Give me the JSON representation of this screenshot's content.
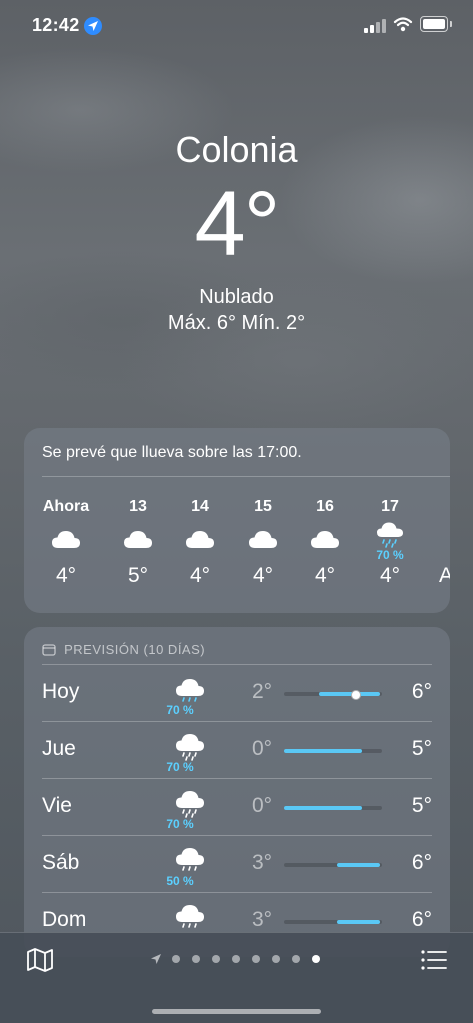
{
  "status": {
    "time": "12:42"
  },
  "location": {
    "city": "Colonia",
    "temperature": "4°",
    "condition": "Nublado",
    "high_low": "Máx. 6°  Mín. 2°"
  },
  "hourly": {
    "summary": "Se prevé que llueva sobre las 17:00.",
    "items": [
      {
        "label": "Ahora",
        "icon": "cloud-icon",
        "temp": "4°",
        "precip": ""
      },
      {
        "label": "13",
        "icon": "cloud-icon",
        "temp": "5°",
        "precip": ""
      },
      {
        "label": "14",
        "icon": "cloud-icon",
        "temp": "4°",
        "precip": ""
      },
      {
        "label": "15",
        "icon": "cloud-icon",
        "temp": "4°",
        "precip": ""
      },
      {
        "label": "16",
        "icon": "cloud-icon",
        "temp": "4°",
        "precip": ""
      },
      {
        "label": "17",
        "icon": "cloud-rain-icon",
        "temp": "4°",
        "precip": "70 %"
      },
      {
        "label": "",
        "icon": "",
        "temp": "A",
        "precip": ""
      }
    ]
  },
  "forecast": {
    "title": "PREVISIÓN (10 DÍAS)",
    "days": [
      {
        "day": "Hoy",
        "icon": "cloud-rain-icon",
        "precip": "70 %",
        "low": "2°",
        "high": "6°",
        "bar_start": 0.36,
        "bar_end": 0.98,
        "current": 0.72
      },
      {
        "day": "Jue",
        "icon": "cloud-rain-icon",
        "precip": "70 %",
        "low": "0°",
        "high": "5°",
        "bar_start": 0.0,
        "bar_end": 0.8,
        "current": null
      },
      {
        "day": "Vie",
        "icon": "cloud-rain-icon",
        "precip": "70 %",
        "low": "0°",
        "high": "5°",
        "bar_start": 0.0,
        "bar_end": 0.8,
        "current": null
      },
      {
        "day": "Sáb",
        "icon": "cloud-rain-icon",
        "precip": "50 %",
        "low": "3°",
        "high": "6°",
        "bar_start": 0.54,
        "bar_end": 0.98,
        "current": null
      },
      {
        "day": "Dom",
        "icon": "cloud-rain-icon",
        "precip": "",
        "low": "3°",
        "high": "6°",
        "bar_start": 0.54,
        "bar_end": 0.98,
        "current": null
      }
    ]
  },
  "toolbar": {
    "map_icon": "map-icon",
    "list_icon": "list-icon",
    "page_count": 8,
    "active_page": 8
  },
  "colors": {
    "precip": "#5bd0ff",
    "temp_bar": "#5ac8f5",
    "location_dot": "#2f8cff"
  }
}
